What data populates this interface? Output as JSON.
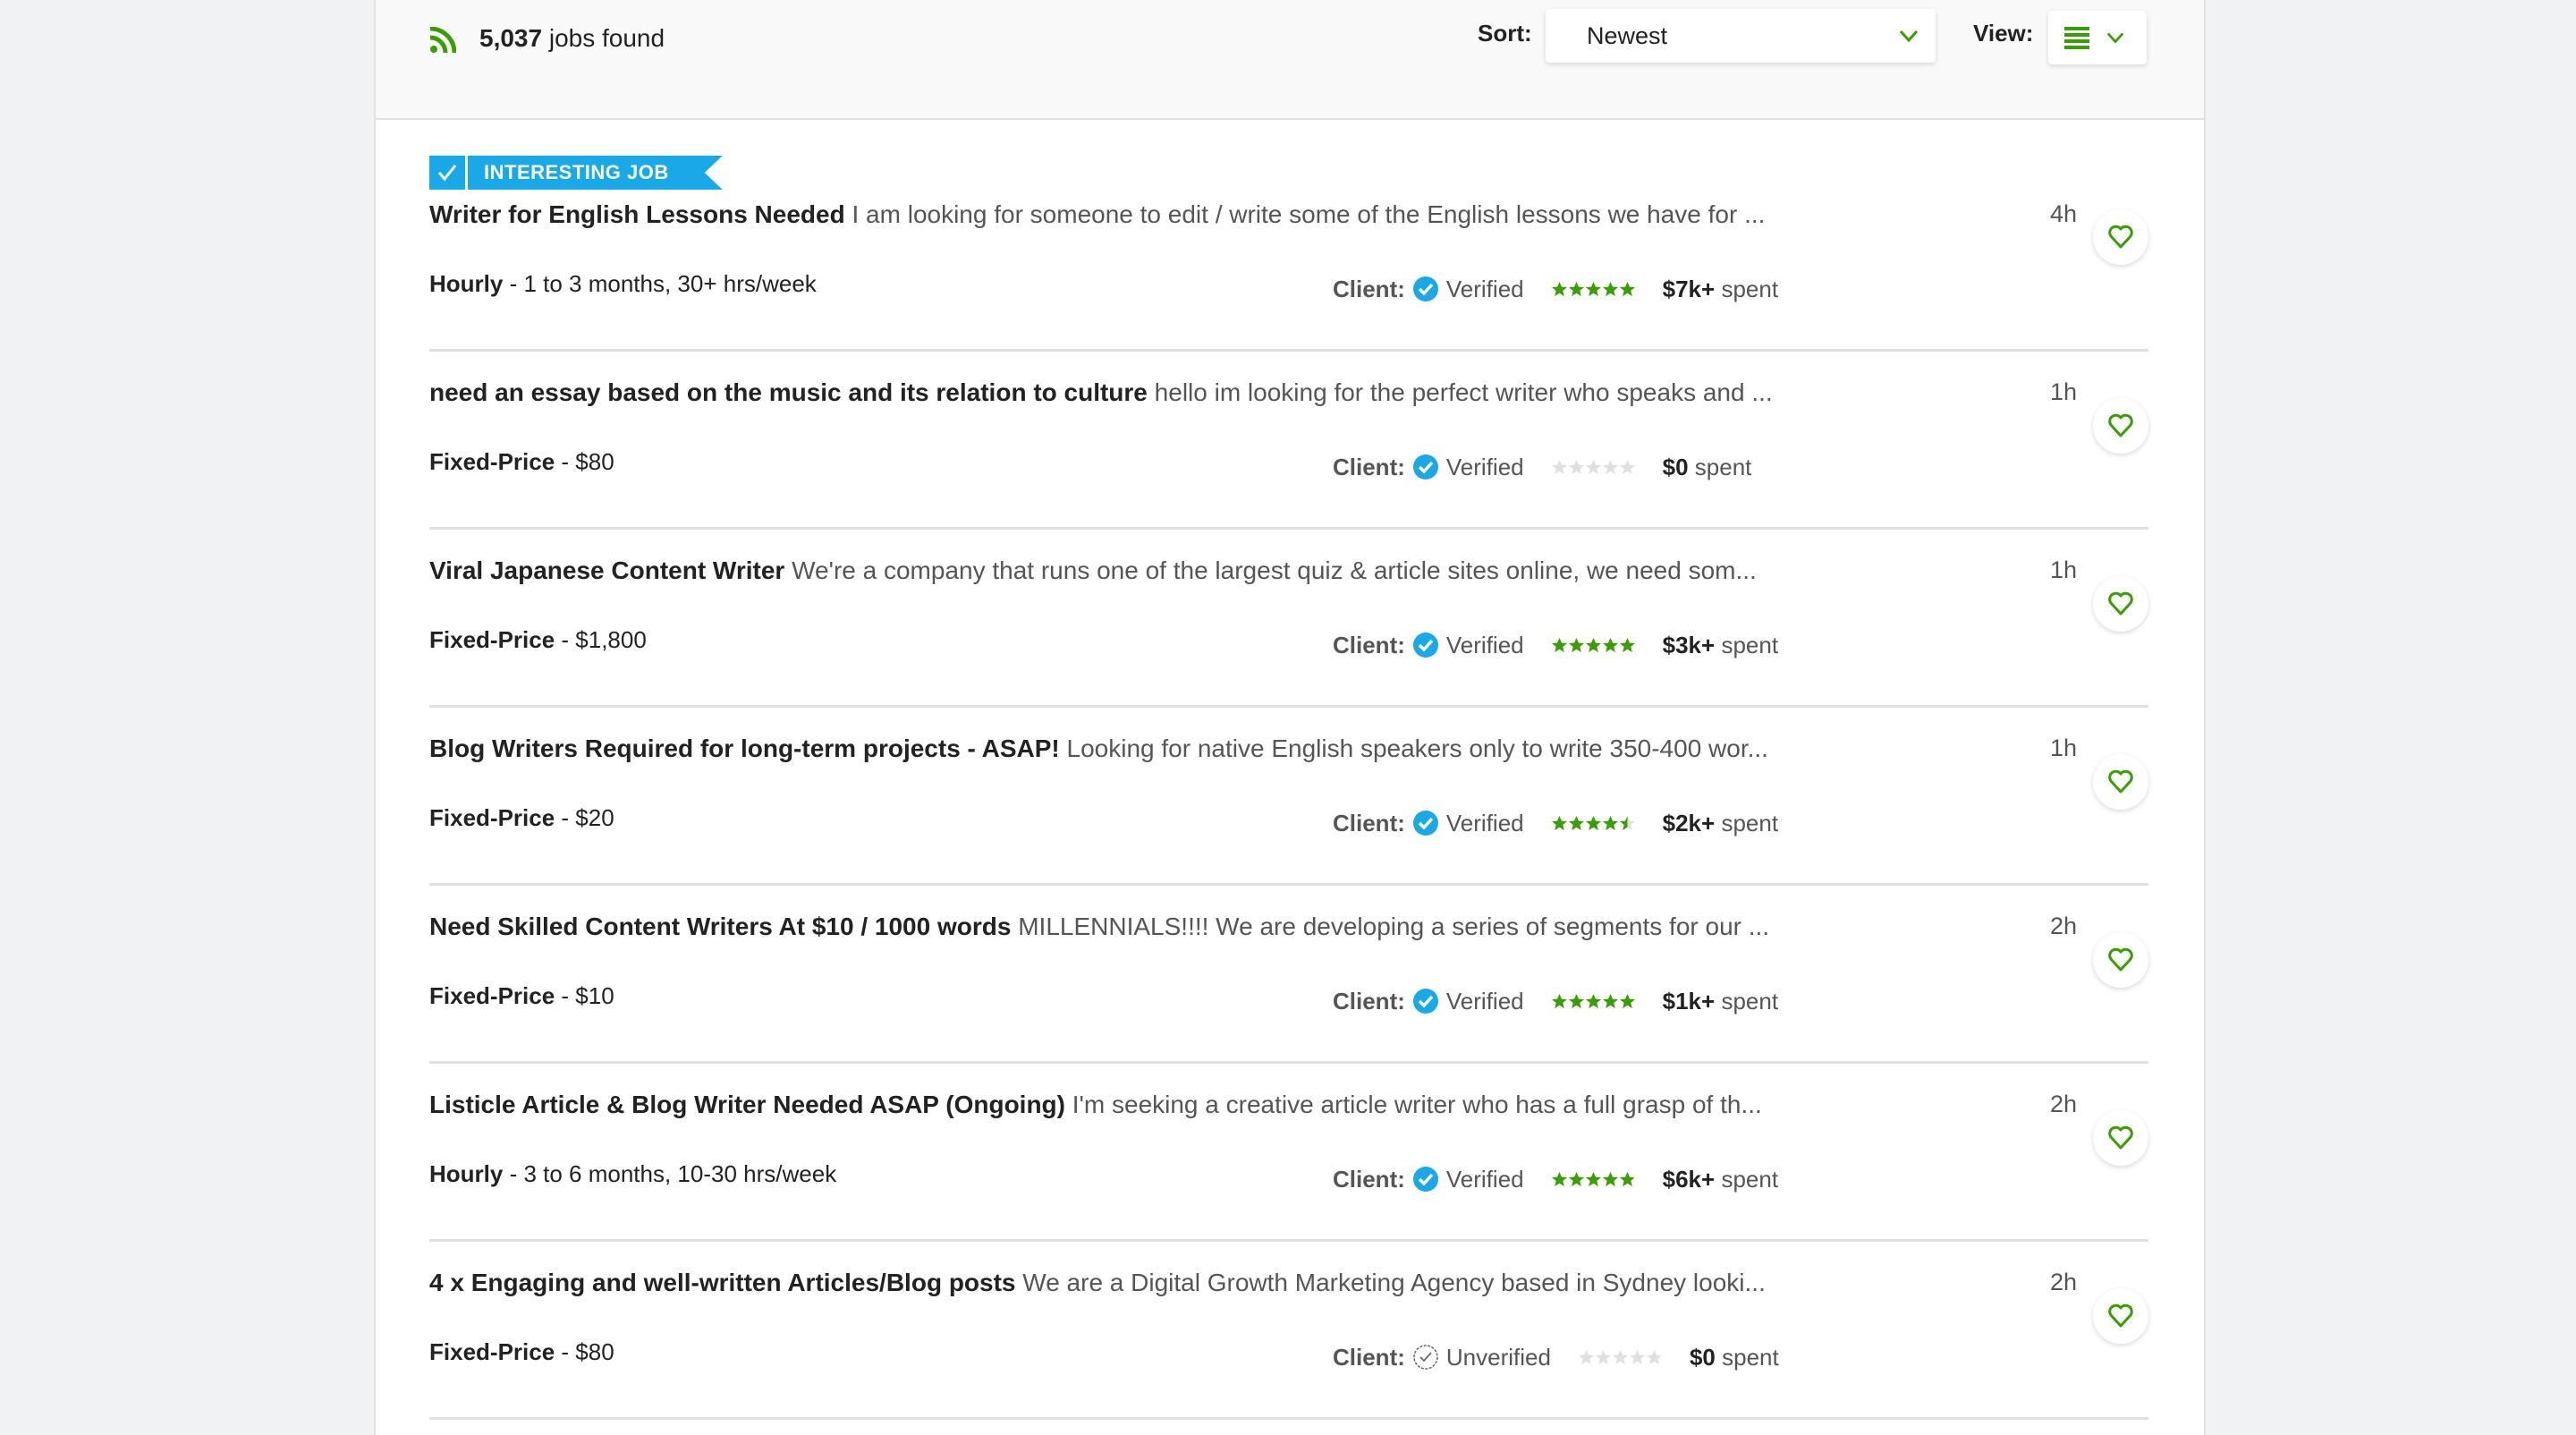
{
  "header": {
    "rss_icon": "rss-feed-icon",
    "jobs_count": "5,037",
    "jobs_found_label": "jobs found",
    "sort_label": "Sort:",
    "sort_value": "Newest",
    "view_label": "View:",
    "view_icon": "list-view-icon"
  },
  "colors": {
    "accent_green": "#37a000",
    "badge_blue": "#1aa9e8",
    "star_empty": "#e0e0e0"
  },
  "jobs": [
    {
      "badge": "INTERESTING JOB",
      "title": "Writer for English Lessons Needed",
      "description": "I am looking for someone to edit / write some of the English lessons we have for ...",
      "age": "4h",
      "type": "Hourly",
      "details": " - 1 to 3 months, 30+ hrs/week",
      "client_label": "Client:",
      "client_status": "Verified",
      "verified": true,
      "rating": 5,
      "spent_amount": "$7k+",
      "spent_label": "spent"
    },
    {
      "title": "need an essay based on the music and its relation to culture",
      "description": "hello im looking for the perfect writer who speaks and ...",
      "age": "1h",
      "type": "Fixed-Price",
      "details": " - $80",
      "client_label": "Client:",
      "client_status": "Verified",
      "verified": true,
      "rating": 0,
      "spent_amount": "$0",
      "spent_label": "spent"
    },
    {
      "title": "Viral Japanese Content Writer",
      "description": "We're a company that runs one of the largest quiz & article sites online, we need som...",
      "age": "1h",
      "type": "Fixed-Price",
      "details": " - $1,800",
      "client_label": "Client:",
      "client_status": "Verified",
      "verified": true,
      "rating": 5,
      "spent_amount": "$3k+",
      "spent_label": "spent"
    },
    {
      "title": "Blog Writers Required for long-term projects - ASAP!",
      "description": "Looking for native English speakers only to write 350-400 wor...",
      "age": "1h",
      "type": "Fixed-Price",
      "details": " - $20",
      "client_label": "Client:",
      "client_status": "Verified",
      "verified": true,
      "rating": 4.5,
      "spent_amount": "$2k+",
      "spent_label": "spent"
    },
    {
      "title": "Need Skilled Content Writers At $10 / 1000 words",
      "description": "MILLENNIALS!!!! We are developing a series of segments for our ...",
      "age": "2h",
      "type": "Fixed-Price",
      "details": " - $10",
      "client_label": "Client:",
      "client_status": "Verified",
      "verified": true,
      "rating": 5,
      "spent_amount": "$1k+",
      "spent_label": "spent"
    },
    {
      "title": "Listicle Article & Blog Writer Needed ASAP (Ongoing)",
      "description": "I'm seeking a creative article writer who has a full grasp of th...",
      "age": "2h",
      "type": "Hourly",
      "details": " - 3 to 6 months, 10-30 hrs/week",
      "client_label": "Client:",
      "client_status": "Verified",
      "verified": true,
      "rating": 4.9,
      "spent_amount": "$6k+",
      "spent_label": "spent"
    },
    {
      "title": "4 x Engaging and well-written Articles/Blog posts",
      "description": "We are a Digital Growth Marketing Agency based in Sydney looki...",
      "age": "2h",
      "type": "Fixed-Price",
      "details": " - $80",
      "client_label": "Client:",
      "client_status": "Unverified",
      "verified": false,
      "rating": 0,
      "spent_amount": "$0",
      "spent_label": "spent"
    }
  ]
}
